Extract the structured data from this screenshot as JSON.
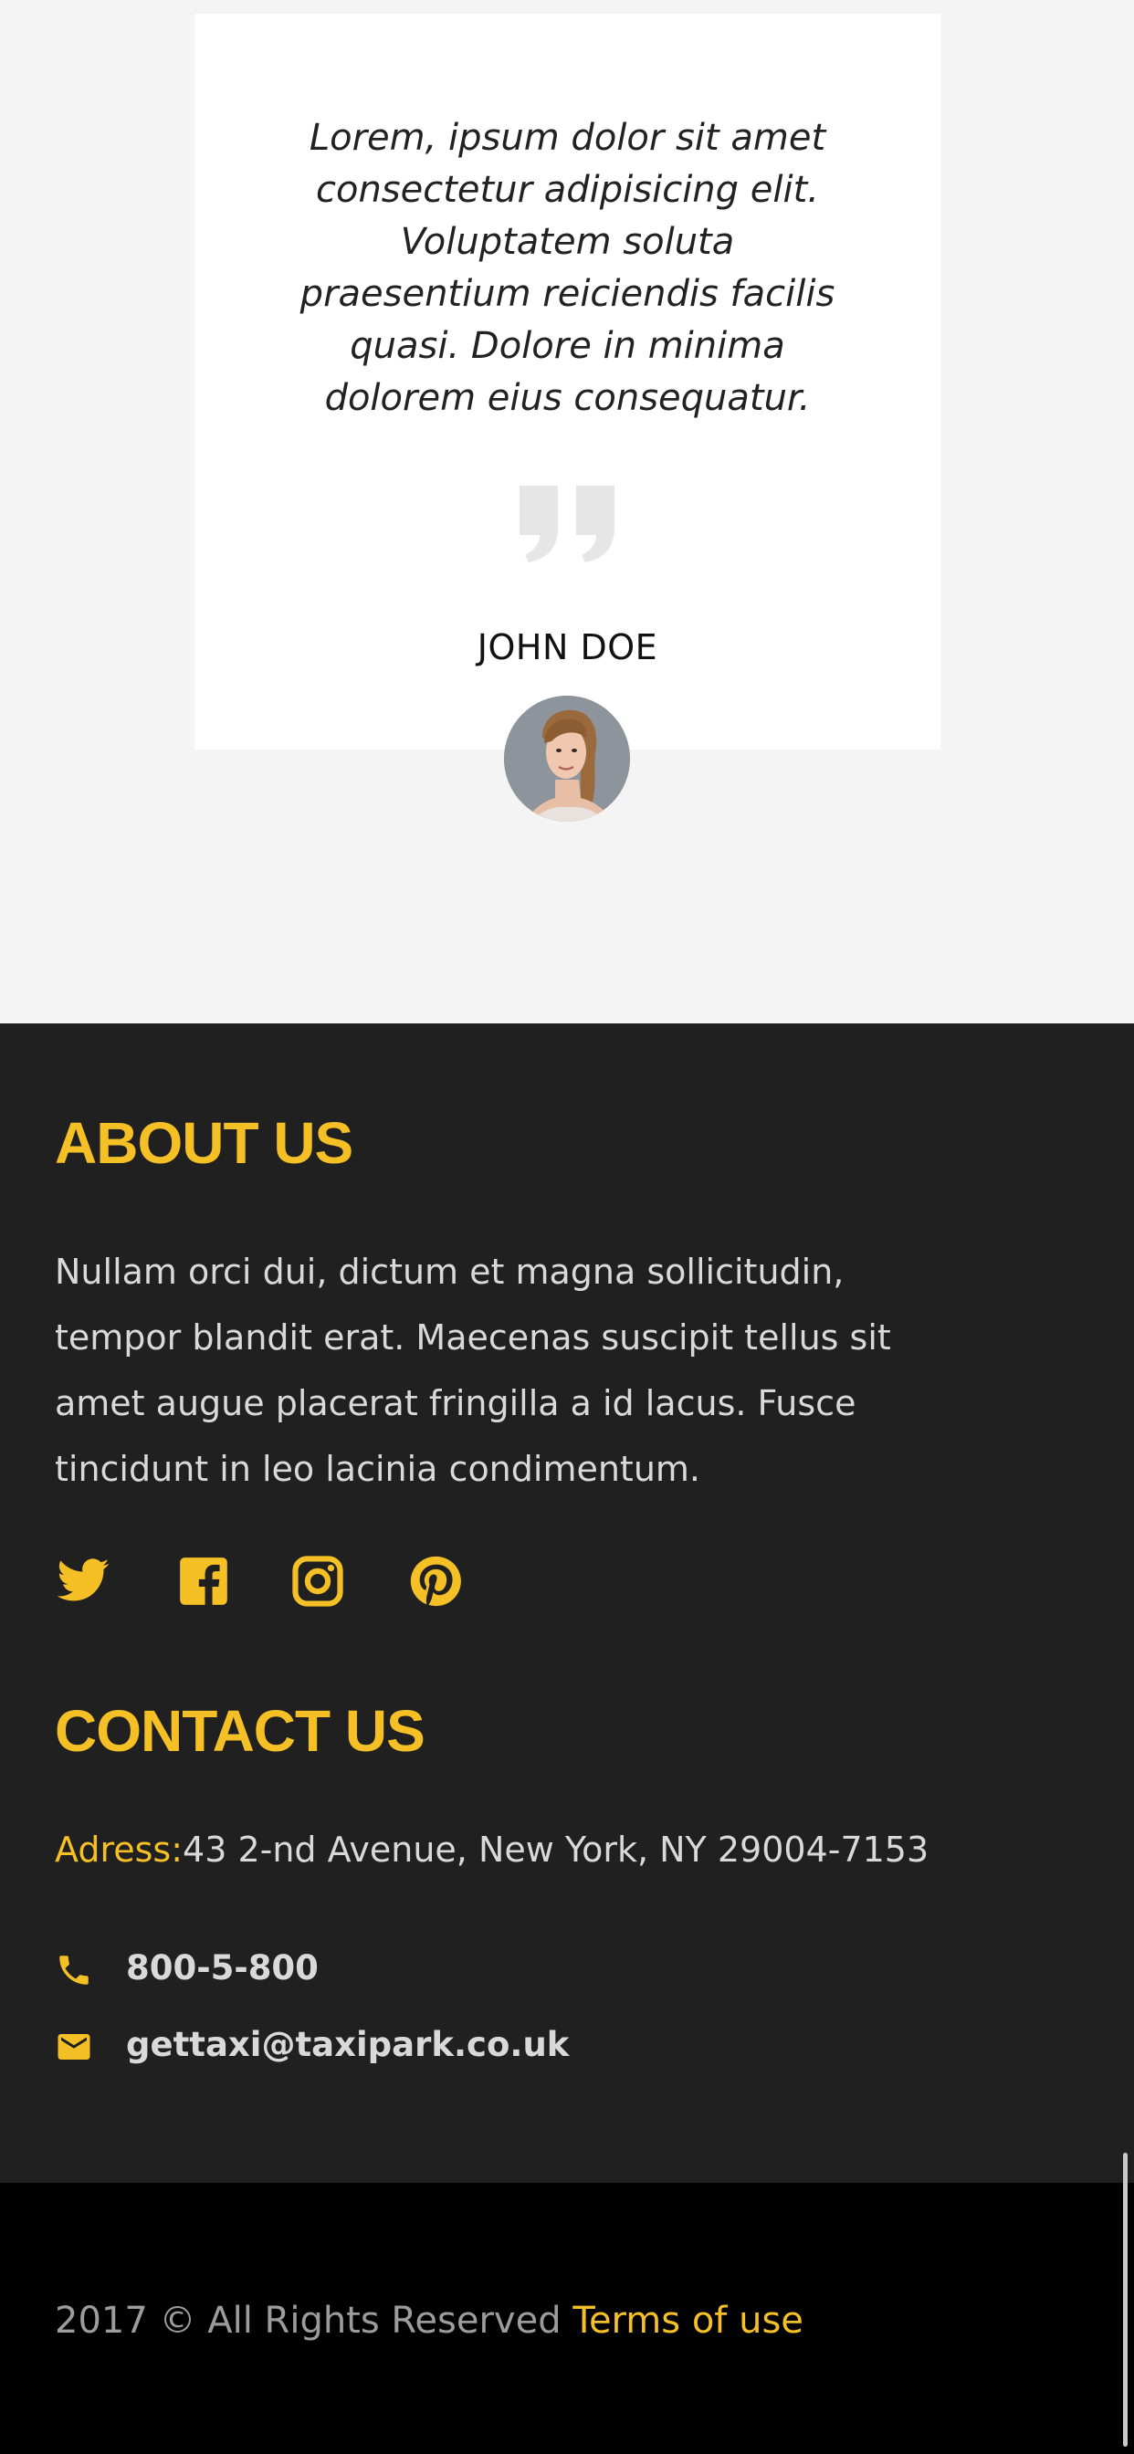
{
  "testimonial": {
    "quote": "Lorem, ipsum dolor sit amet consectetur adipisicing elit. Voluptatem soluta praesentium reiciendis facilis quasi. Dolore in minima dolorem eius consequatur.",
    "author": "JOHN DOE",
    "quote_icon": "quote-mark-icon"
  },
  "footer": {
    "about": {
      "heading": "ABOUT US",
      "text": "Nullam orci dui, dictum et magna sollicitudin, tempor blandit erat. Maecenas suscipit tellus sit amet augue placerat fringilla a id lacus. Fusce tincidunt in leo lacinia condimentum."
    },
    "social": [
      {
        "name": "twitter",
        "icon": "twitter-icon"
      },
      {
        "name": "facebook",
        "icon": "facebook-icon"
      },
      {
        "name": "instagram",
        "icon": "instagram-icon"
      },
      {
        "name": "pinterest",
        "icon": "pinterest-icon"
      }
    ],
    "contact": {
      "heading": "CONTACT US",
      "address_label": "Adress:",
      "address_value": "43 2-nd Avenue, New York, NY 29004-7153",
      "phone": "800-5-800",
      "phone_icon": "phone-icon",
      "email": "gettaxi@taxipark.co.uk",
      "email_icon": "mail-icon"
    }
  },
  "bottom": {
    "copyright": "2017 © All Rights Reserved",
    "terms_label": "Terms of use"
  },
  "colors": {
    "accent": "#f5c026",
    "footer_bg": "#202020",
    "bottom_bg": "#000000",
    "page_bg": "#f4f4f4",
    "card_bg": "#ffffff"
  }
}
